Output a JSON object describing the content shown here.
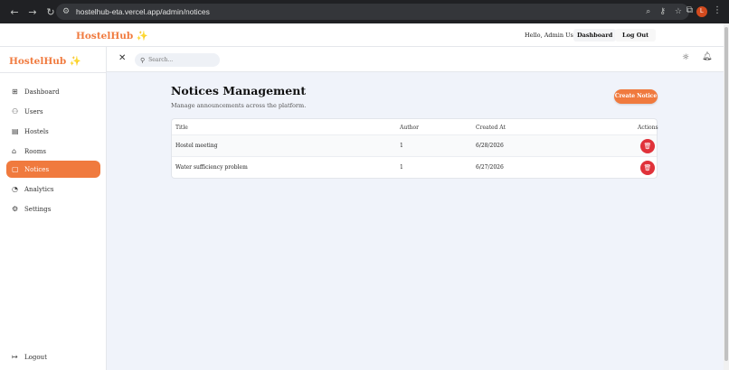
{
  "browser": {
    "url": "hostelhub-eta.vercel.app/admin/notices",
    "profile_initial": "L"
  },
  "topbar": {
    "brand": "HostelHub",
    "greeting": "Hello, Admin User",
    "dashboard_label": "Dashboard",
    "logout_label": "Log Out"
  },
  "sidebar": {
    "brand": "HostelHub",
    "items": [
      {
        "label": "Dashboard",
        "icon": "grid-icon"
      },
      {
        "label": "Users",
        "icon": "users-icon"
      },
      {
        "label": "Hostels",
        "icon": "building-icon"
      },
      {
        "label": "Rooms",
        "icon": "home-icon"
      },
      {
        "label": "Notices",
        "icon": "message-icon",
        "active": true
      },
      {
        "label": "Analytics",
        "icon": "pie-chart-icon"
      },
      {
        "label": "Settings",
        "icon": "gear-icon"
      }
    ],
    "logout_label": "Logout"
  },
  "header": {
    "search_placeholder": "Search..."
  },
  "main": {
    "title": "Notices Management",
    "subtitle": "Manage announcements across the platform.",
    "create_label": "Create Notice",
    "table": {
      "columns": [
        "Title",
        "Author",
        "Created At",
        "Actions"
      ],
      "rows": [
        {
          "title": "Hostel meeting",
          "author": "1",
          "created": "6/28/2026"
        },
        {
          "title": "Water sufficiency problem",
          "author": "1",
          "created": "6/27/2026"
        }
      ]
    }
  },
  "colors": {
    "accent": "#f07a3e",
    "danger": "#e0323a",
    "background": "#f0f3fa"
  }
}
